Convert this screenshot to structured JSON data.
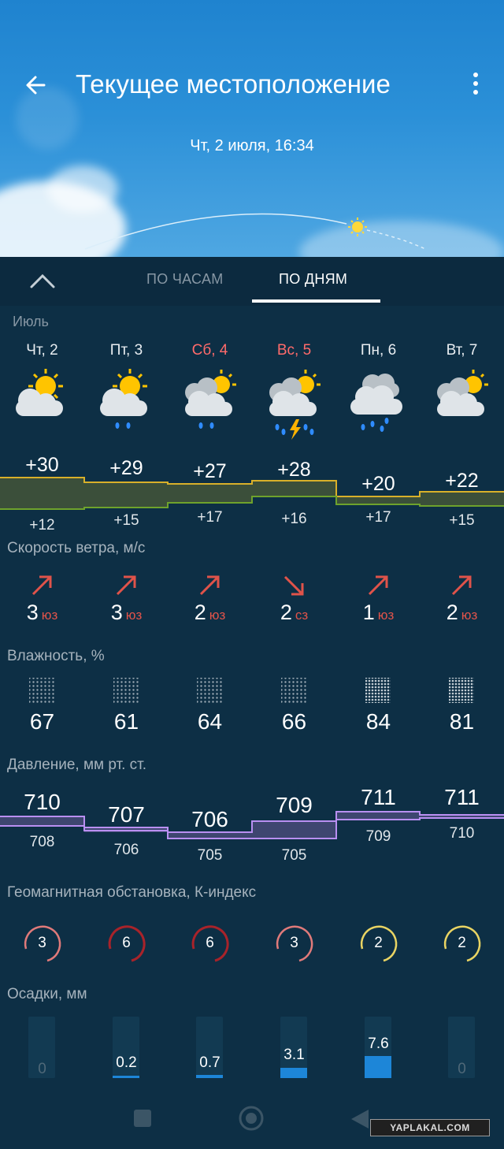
{
  "header": {
    "title": "Текущее местоположение",
    "datetime": "Чт, 2 июля, 16:34"
  },
  "tabs": [
    {
      "label": "ПО ЧАСАМ",
      "active": false
    },
    {
      "label": "ПО ДНЯМ",
      "active": true
    }
  ],
  "month_label": "Июль",
  "days": [
    {
      "name": "Чт, 2",
      "weekend": false,
      "icon": "partly-cloudy-icon",
      "tmax": "+30",
      "tmin": "+12",
      "wind_speed": "3",
      "wind_dir": "юз",
      "humidity": "67",
      "pressure_max": "710",
      "pressure_min": "708",
      "k_index": "3",
      "precip": "0"
    },
    {
      "name": "Пт, 3",
      "weekend": false,
      "icon": "partly-cloudy-light-rain-icon",
      "tmax": "+29",
      "tmin": "+15",
      "wind_speed": "3",
      "wind_dir": "юз",
      "humidity": "61",
      "pressure_max": "707",
      "pressure_min": "706",
      "k_index": "6",
      "precip": "0.2"
    },
    {
      "name": "Сб, 4",
      "weekend": true,
      "icon": "cloudy-light-rain-icon",
      "tmax": "+27",
      "tmin": "+17",
      "wind_speed": "2",
      "wind_dir": "юз",
      "humidity": "64",
      "pressure_max": "706",
      "pressure_min": "705",
      "k_index": "6",
      "precip": "0.7"
    },
    {
      "name": "Вс, 5",
      "weekend": true,
      "icon": "thunderstorm-rain-icon",
      "tmax": "+28",
      "tmin": "+16",
      "wind_speed": "2",
      "wind_dir": "сз",
      "humidity": "66",
      "pressure_max": "709",
      "pressure_min": "705",
      "k_index": "3",
      "precip": "3.1"
    },
    {
      "name": "Пн, 6",
      "weekend": false,
      "icon": "overcast-rain-icon",
      "tmax": "+20",
      "tmin": "+17",
      "wind_speed": "1",
      "wind_dir": "юз",
      "humidity": "84",
      "pressure_max": "711",
      "pressure_min": "709",
      "k_index": "2",
      "precip": "7.6"
    },
    {
      "name": "Вт, 7",
      "weekend": false,
      "icon": "partly-cloudy-icon",
      "tmax": "+22",
      "tmin": "+15",
      "wind_speed": "2",
      "wind_dir": "юз",
      "humidity": "81",
      "pressure_max": "711",
      "pressure_min": "710",
      "k_index": "2",
      "precip": "0"
    }
  ],
  "sections": {
    "wind": "Скорость ветра, м/с",
    "humidity": "Влажность, %",
    "pressure": "Давление, мм рт. ст.",
    "geomag": "Геомагнитная обстановка, К-индекс",
    "precip": "Осадки, мм"
  },
  "watermark": "YAPLAKAL.COM",
  "colors": {
    "background": "#0d2f45",
    "temp_line": "#d8b02a",
    "pressure_line": "#b98ff2",
    "wind_arrow": "#e0534a",
    "k_low": "#e9d463",
    "k_mid": "#e07a7a",
    "k_high": "#a8232a",
    "precip_fill": "#1d86d8"
  }
}
